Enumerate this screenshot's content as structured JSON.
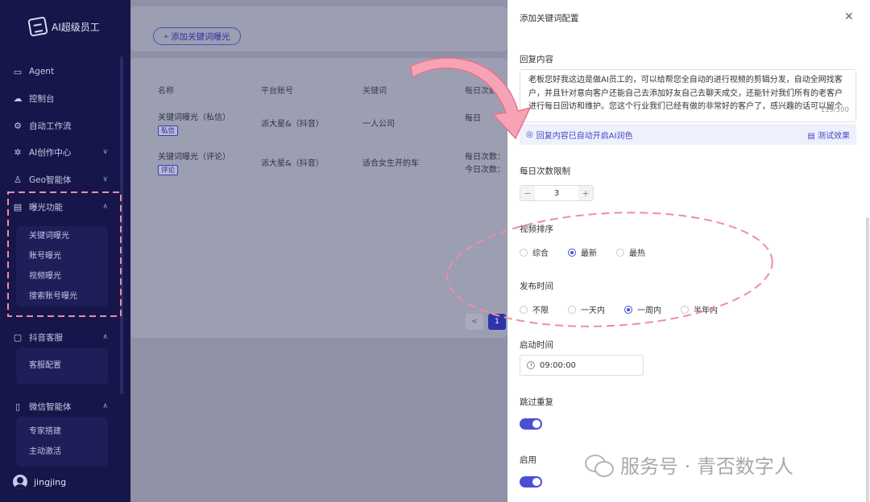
{
  "sidebar": {
    "brand": "AI超级员工",
    "items": [
      {
        "label": "Agent",
        "icon": "monitor-icon"
      },
      {
        "label": "控制台",
        "icon": "cloud-icon"
      },
      {
        "label": "自动工作流",
        "icon": "workflow-icon"
      },
      {
        "label": "AI创作中心",
        "icon": "sparkle-icon"
      },
      {
        "label": "Geo智能体",
        "icon": "user-icon"
      },
      {
        "label": "曝光功能",
        "icon": "screen-icon"
      },
      {
        "label": "抖音客服",
        "icon": "chat-icon"
      },
      {
        "label": "微信智能体",
        "icon": "phone-icon"
      }
    ],
    "exposure_sub": [
      "关键词曝光",
      "账号曝光",
      "视频曝光",
      "搜索账号曝光"
    ],
    "service_sub": [
      "客服配置"
    ],
    "wechat_sub": [
      "专家搭建",
      "主动激活"
    ],
    "user": "jingjing"
  },
  "main": {
    "add_button": "+ 添加关键词曝光",
    "columns": [
      "名称",
      "平台账号",
      "关键词",
      "每日次数"
    ],
    "rows": [
      {
        "name": "关键词曝光（私信）",
        "tag": "私信",
        "account": "派大星&（抖音）",
        "keyword": "一人公司",
        "daily": "每日"
      },
      {
        "name": "关键词曝光（评论）",
        "tag": "评论",
        "account": "派大星&（抖音）",
        "keyword": "适合女生开的车",
        "daily": "每日次数：",
        "daily2": "今日次数："
      }
    ],
    "page": "1",
    "prev": "<"
  },
  "drawer": {
    "title": "添加关键词配置",
    "reply_label": "回复内容",
    "reply_text": "老板您好我这边是做AI员工的，可以给帮您全自动的进行视频的剪辑分发，自动全网找客户，并且针对意向客户还能自己去添加好友自己去聊天成交，还能针对我们所有的老客户进行每日回访和维护。您这个行业我们已经有做的非常好的客户了，感兴趣的话可以留个",
    "reply_count": "119/500",
    "ai_notice": "回复内容已自动开启AI润色",
    "test_label": "测试效果",
    "daily_label": "每日次数限制",
    "daily_value": "3",
    "sort_label": "视频排序",
    "sort_options": [
      "综合",
      "最新",
      "最热"
    ],
    "sort_selected": "最新",
    "publish_label": "发布时间",
    "publish_options": [
      "不限",
      "一天内",
      "一周内",
      "半年内"
    ],
    "publish_selected": "一周内",
    "start_label": "启动时间",
    "start_value": "09:00:00",
    "skip_label": "跳过重复",
    "skip_on": true,
    "enable_label": "启用",
    "enable_on": true
  },
  "watermark": "服务号 · 青否数字人",
  "colors": {
    "accent": "#4b4fd6",
    "sidebar": "#16164a",
    "annotation": "#f08ca5"
  }
}
